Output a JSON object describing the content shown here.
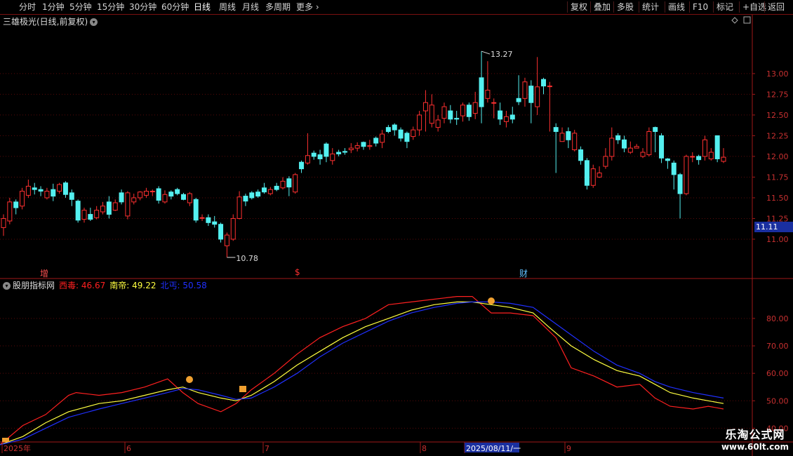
{
  "toolbar": {
    "periods": [
      "分时",
      "1分钟",
      "5分钟",
      "15分钟",
      "30分钟",
      "60分钟",
      "日线",
      "周线",
      "月线",
      "多周期",
      "更多"
    ],
    "right_items": [
      "复权",
      "叠加",
      "多股",
      "统计",
      "画线",
      "F10",
      "标记",
      "+自选",
      "返回"
    ]
  },
  "main_title": "三雄极光(日线,前复权)",
  "indicator": {
    "name": "股朋指标网",
    "series": [
      {
        "label": "西毒:",
        "value": "46.67",
        "color": "#ff2020"
      },
      {
        "label": "南帝:",
        "value": "49.22",
        "color": "#ffff40"
      },
      {
        "label": "北丐:",
        "value": "50.58",
        "color": "#2030ff"
      }
    ]
  },
  "markers": {
    "zeng": "增",
    "dollar": "$",
    "cai": "财"
  },
  "price_tag": "11.11",
  "watermark": {
    "line1": "乐淘公式网",
    "line2": "www.60lt.com"
  },
  "chart_data": [
    {
      "type": "candlestick",
      "title": "三雄极光(日线,前复权)",
      "ylim": [
        10.72,
        13.55
      ],
      "y_ticks": [
        "13.00",
        "12.75",
        "12.50",
        "12.25",
        "12.00",
        "11.75",
        "11.50",
        "11.25",
        "11.00"
      ],
      "annotations": [
        {
          "text": "13.27",
          "value": 13.27
        },
        {
          "text": "10.78",
          "value": 10.78
        }
      ],
      "up_color": "#ff3030",
      "down_color": "#54f0f0",
      "candles": [
        [
          11.14,
          11.25,
          11.04,
          11.3
        ],
        [
          11.22,
          11.45,
          11.18,
          11.5
        ],
        [
          11.45,
          11.38,
          11.3,
          11.48
        ],
        [
          11.4,
          11.58,
          11.36,
          11.62
        ],
        [
          11.53,
          11.64,
          11.5,
          11.72
        ],
        [
          11.62,
          11.6,
          11.54,
          11.68
        ],
        [
          11.6,
          11.58,
          11.52,
          11.64
        ],
        [
          11.5,
          11.58,
          11.48,
          11.62
        ],
        [
          11.6,
          11.52,
          11.46,
          11.67
        ],
        [
          11.58,
          11.66,
          11.55,
          11.68
        ],
        [
          11.68,
          11.54,
          11.5,
          11.7
        ],
        [
          11.56,
          11.48,
          11.4,
          11.6
        ],
        [
          11.46,
          11.23,
          11.2,
          11.48
        ],
        [
          11.24,
          11.35,
          11.2,
          11.38
        ],
        [
          11.3,
          11.24,
          11.22,
          11.38
        ],
        [
          11.26,
          11.35,
          11.24,
          11.4
        ],
        [
          11.33,
          11.4,
          11.3,
          11.45
        ],
        [
          11.45,
          11.3,
          11.25,
          11.52
        ],
        [
          11.35,
          11.44,
          11.34,
          11.48
        ],
        [
          11.56,
          11.45,
          11.42,
          11.6
        ],
        [
          11.28,
          11.56,
          11.24,
          11.58
        ],
        [
          11.45,
          11.5,
          11.42,
          11.55
        ],
        [
          11.5,
          11.57,
          11.47,
          11.58
        ],
        [
          11.53,
          11.58,
          11.5,
          11.62
        ],
        [
          11.58,
          11.58,
          11.52,
          11.6
        ],
        [
          11.61,
          11.47,
          11.43,
          11.64
        ],
        [
          11.45,
          11.54,
          11.43,
          11.59
        ],
        [
          11.57,
          11.52,
          11.48,
          11.59
        ],
        [
          11.6,
          11.55,
          11.53,
          11.62
        ],
        [
          11.54,
          11.48,
          11.47,
          11.56
        ],
        [
          11.44,
          11.55,
          11.4,
          11.57
        ],
        [
          11.48,
          11.23,
          11.2,
          11.5
        ],
        [
          11.26,
          11.26,
          11.22,
          11.3
        ],
        [
          11.26,
          11.2,
          11.16,
          11.3
        ],
        [
          11.21,
          11.18,
          11.14,
          11.28
        ],
        [
          11.18,
          11.0,
          10.96,
          11.2
        ],
        [
          10.92,
          11.05,
          10.78,
          11.08
        ],
        [
          11.0,
          11.25,
          10.98,
          11.3
        ],
        [
          11.25,
          11.51,
          11.24,
          11.58
        ],
        [
          11.52,
          11.46,
          11.4,
          11.55
        ],
        [
          11.56,
          11.5,
          11.48,
          11.58
        ],
        [
          11.57,
          11.52,
          11.5,
          11.6
        ],
        [
          11.62,
          11.57,
          11.55,
          11.68
        ],
        [
          11.55,
          11.6,
          11.53,
          11.63
        ],
        [
          11.64,
          11.6,
          11.58,
          11.68
        ],
        [
          11.62,
          11.7,
          11.6,
          11.75
        ],
        [
          11.73,
          11.63,
          11.52,
          11.76
        ],
        [
          11.57,
          11.78,
          11.55,
          11.8
        ],
        [
          11.93,
          11.85,
          11.8,
          11.95
        ],
        [
          11.92,
          12.01,
          11.9,
          12.28
        ],
        [
          12.04,
          12.0,
          11.96,
          12.07
        ],
        [
          12.02,
          11.97,
          11.9,
          12.08
        ],
        [
          12.15,
          12.0,
          11.93,
          12.17
        ],
        [
          11.95,
          12.03,
          11.9,
          12.1
        ],
        [
          12.05,
          12.03,
          12.0,
          12.08
        ],
        [
          12.06,
          12.05,
          12.02,
          12.1
        ],
        [
          12.08,
          12.1,
          12.04,
          12.16
        ],
        [
          12.1,
          12.13,
          12.06,
          12.17
        ],
        [
          12.17,
          12.12,
          12.08,
          12.18
        ],
        [
          12.12,
          12.13,
          12.08,
          12.2
        ],
        [
          12.22,
          12.16,
          12.12,
          12.24
        ],
        [
          12.17,
          12.27,
          12.1,
          12.32
        ],
        [
          12.35,
          12.3,
          12.28,
          12.38
        ],
        [
          12.38,
          12.32,
          12.25,
          12.4
        ],
        [
          12.32,
          12.22,
          12.18,
          12.35
        ],
        [
          12.28,
          12.18,
          12.1,
          12.3
        ],
        [
          12.24,
          12.32,
          12.2,
          12.36
        ],
        [
          12.32,
          12.5,
          12.25,
          12.55
        ],
        [
          12.55,
          12.65,
          12.3,
          12.8
        ],
        [
          12.4,
          12.62,
          12.35,
          12.75
        ],
        [
          12.35,
          12.44,
          12.3,
          12.5
        ],
        [
          12.46,
          12.6,
          12.4,
          12.65
        ],
        [
          12.55,
          12.45,
          12.4,
          12.62
        ],
        [
          12.46,
          12.45,
          12.38,
          12.55
        ],
        [
          12.49,
          12.62,
          12.42,
          12.65
        ],
        [
          12.62,
          12.48,
          12.43,
          12.65
        ],
        [
          12.52,
          12.65,
          12.45,
          12.78
        ],
        [
          12.95,
          12.6,
          12.4,
          13.27
        ],
        [
          12.7,
          12.8,
          12.65,
          13.15
        ],
        [
          12.65,
          12.65,
          12.46,
          12.7
        ],
        [
          12.55,
          12.45,
          12.38,
          12.65
        ],
        [
          12.42,
          12.48,
          12.35,
          12.55
        ],
        [
          12.5,
          12.45,
          12.4,
          12.6
        ],
        [
          12.7,
          12.66,
          12.62,
          12.98
        ],
        [
          12.7,
          12.9,
          12.6,
          12.95
        ],
        [
          12.85,
          12.65,
          12.4,
          12.92
        ],
        [
          12.6,
          12.84,
          12.5,
          13.2
        ],
        [
          12.93,
          12.85,
          12.75,
          12.95
        ],
        [
          12.85,
          12.85,
          12.3,
          12.9
        ],
        [
          12.35,
          12.3,
          11.8,
          12.4
        ],
        [
          12.18,
          12.28,
          12.18,
          12.35
        ],
        [
          12.3,
          12.2,
          12.1,
          12.35
        ],
        [
          12.08,
          12.28,
          12.06,
          12.32
        ],
        [
          12.08,
          11.95,
          11.9,
          12.12
        ],
        [
          11.95,
          11.65,
          11.6,
          11.98
        ],
        [
          11.65,
          11.85,
          11.62,
          11.9
        ],
        [
          11.75,
          11.8,
          11.74,
          11.88
        ],
        [
          11.88,
          12.0,
          11.85,
          12.1
        ],
        [
          12.0,
          12.22,
          11.95,
          12.35
        ],
        [
          12.25,
          12.2,
          12.15,
          12.28
        ],
        [
          12.2,
          12.1,
          12.05,
          12.25
        ],
        [
          12.05,
          12.1,
          12.03,
          12.18
        ],
        [
          12.1,
          12.12,
          12.1,
          12.15
        ],
        [
          12.0,
          12.05,
          11.98,
          12.1
        ],
        [
          12.02,
          12.3,
          12.0,
          12.35
        ],
        [
          12.35,
          12.3,
          12.05,
          12.36
        ],
        [
          12.25,
          11.98,
          11.92,
          12.28
        ],
        [
          11.97,
          11.95,
          11.85,
          11.98
        ],
        [
          11.92,
          11.78,
          11.6,
          11.95
        ],
        [
          11.78,
          11.55,
          11.25,
          11.8
        ],
        [
          11.55,
          12.0,
          11.53,
          12.02
        ],
        [
          12.0,
          12.0,
          11.93,
          12.05
        ],
        [
          12.0,
          11.96,
          11.9,
          12.02
        ],
        [
          12.0,
          12.2,
          11.95,
          12.25
        ],
        [
          11.97,
          12.05,
          11.95,
          12.1
        ],
        [
          12.25,
          11.97,
          11.93,
          12.25
        ],
        [
          11.94,
          11.99,
          11.92,
          12.1
        ]
      ]
    },
    {
      "type": "line",
      "title": "股朋指标网",
      "ylim": [
        35,
        93
      ],
      "y_ticks": [
        "80.00",
        "70.00",
        "60.00",
        "50.00",
        "40.00"
      ],
      "x_ticks": [
        "2025年",
        "6",
        "7",
        "8",
        "2025/08/11/一",
        "9"
      ],
      "series": [
        {
          "name": "西毒",
          "color": "#ff2020",
          "values": [
            [
              0,
              34
            ],
            [
              0.03,
              41
            ],
            [
              0.06,
              45
            ],
            [
              0.09,
              52
            ],
            [
              0.1,
              53
            ],
            [
              0.13,
              52
            ],
            [
              0.16,
              53
            ],
            [
              0.19,
              55
            ],
            [
              0.22,
              58
            ],
            [
              0.24,
              53
            ],
            [
              0.26,
              49
            ],
            [
              0.29,
              46
            ],
            [
              0.31,
              49
            ],
            [
              0.33,
              54
            ],
            [
              0.36,
              60
            ],
            [
              0.39,
              67
            ],
            [
              0.42,
              73
            ],
            [
              0.45,
              77
            ],
            [
              0.48,
              80
            ],
            [
              0.51,
              85
            ],
            [
              0.54,
              86
            ],
            [
              0.57,
              87
            ],
            [
              0.6,
              88
            ],
            [
              0.62,
              88
            ],
            [
              0.645,
              82
            ],
            [
              0.67,
              82
            ],
            [
              0.7,
              81
            ],
            [
              0.73,
              73
            ],
            [
              0.75,
              62
            ],
            [
              0.78,
              59
            ],
            [
              0.81,
              55
            ],
            [
              0.84,
              56
            ],
            [
              0.86,
              51
            ],
            [
              0.88,
              48
            ],
            [
              0.91,
              47
            ],
            [
              0.93,
              48
            ],
            [
              0.95,
              47
            ]
          ]
        },
        {
          "name": "南帝",
          "color": "#ffff40",
          "values": [
            [
              0,
              34
            ],
            [
              0.03,
              37
            ],
            [
              0.06,
              42
            ],
            [
              0.09,
              46
            ],
            [
              0.13,
              49
            ],
            [
              0.16,
              50
            ],
            [
              0.19,
              52
            ],
            [
              0.22,
              54
            ],
            [
              0.24,
              55
            ],
            [
              0.26,
              53
            ],
            [
              0.29,
              51
            ],
            [
              0.31,
              50
            ],
            [
              0.33,
              52
            ],
            [
              0.36,
              57
            ],
            [
              0.39,
              63
            ],
            [
              0.42,
              68
            ],
            [
              0.45,
              73
            ],
            [
              0.48,
              77
            ],
            [
              0.51,
              80
            ],
            [
              0.54,
              83
            ],
            [
              0.57,
              85
            ],
            [
              0.6,
              86
            ],
            [
              0.62,
              86
            ],
            [
              0.645,
              85
            ],
            [
              0.67,
              84
            ],
            [
              0.7,
              82
            ],
            [
              0.72,
              77
            ],
            [
              0.75,
              70
            ],
            [
              0.78,
              65
            ],
            [
              0.81,
              61
            ],
            [
              0.84,
              59
            ],
            [
              0.86,
              56
            ],
            [
              0.88,
              53
            ],
            [
              0.91,
              51
            ],
            [
              0.93,
              50
            ],
            [
              0.95,
              49
            ]
          ]
        },
        {
          "name": "北丐",
          "color": "#2030ff",
          "values": [
            [
              0,
              34
            ],
            [
              0.03,
              36
            ],
            [
              0.06,
              40
            ],
            [
              0.09,
              44
            ],
            [
              0.13,
              47
            ],
            [
              0.16,
              49
            ],
            [
              0.19,
              51
            ],
            [
              0.22,
              53
            ],
            [
              0.24,
              54.5
            ],
            [
              0.26,
              54
            ],
            [
              0.29,
              52
            ],
            [
              0.31,
              50.5
            ],
            [
              0.33,
              51
            ],
            [
              0.36,
              55
            ],
            [
              0.39,
              60
            ],
            [
              0.42,
              66
            ],
            [
              0.45,
              71
            ],
            [
              0.48,
              75
            ],
            [
              0.51,
              79
            ],
            [
              0.54,
              82
            ],
            [
              0.57,
              84
            ],
            [
              0.6,
              85.5
            ],
            [
              0.62,
              86
            ],
            [
              0.645,
              86
            ],
            [
              0.67,
              85.5
            ],
            [
              0.7,
              84
            ],
            [
              0.72,
              80
            ],
            [
              0.75,
              74
            ],
            [
              0.78,
              68
            ],
            [
              0.81,
              63
            ],
            [
              0.84,
              60
            ],
            [
              0.86,
              57
            ],
            [
              0.88,
              55
            ],
            [
              0.91,
              53
            ],
            [
              0.93,
              52
            ],
            [
              0.95,
              51
            ]
          ]
        }
      ]
    }
  ]
}
